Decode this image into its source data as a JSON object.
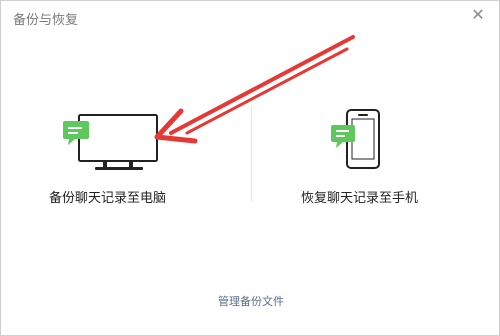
{
  "window": {
    "title": "备份与恢复",
    "close_glyph": "✕"
  },
  "options": [
    {
      "label": "备份聊天记录至电脑",
      "icon": "monitor-chat-icon"
    },
    {
      "label": "恢复聊天记录至手机",
      "icon": "phone-chat-icon"
    }
  ],
  "footer": {
    "manage_label": "管理备份文件"
  },
  "colors": {
    "accent_green": "#5fc85c",
    "annotation_red": "#e53935",
    "link": "#5a6e8a"
  }
}
